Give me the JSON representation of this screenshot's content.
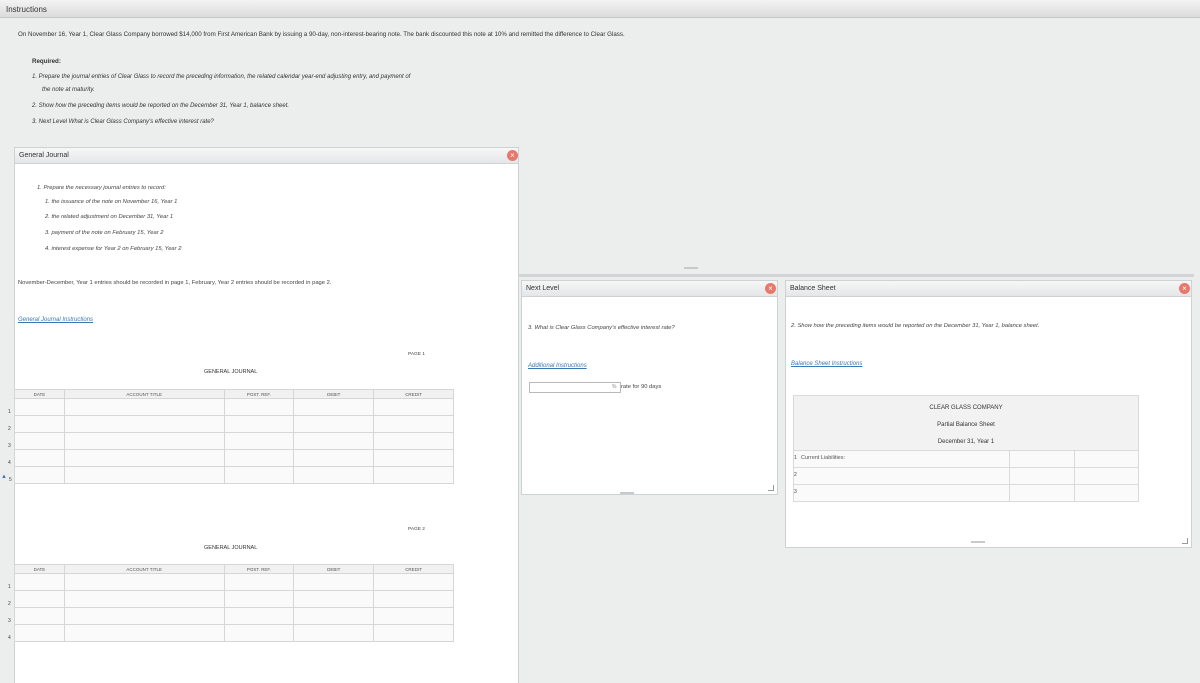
{
  "window": {
    "title": "Instructions"
  },
  "intro": "On November 16, Year 1, Clear Glass Company borrowed $14,000 from First American Bank by issuing a 90-day, non-interest-bearing note. The bank discounted this note at 10% and remitted the difference to Clear Glass.",
  "required": {
    "title": "Required:",
    "items": [
      "1. Prepare the journal entries of Clear Glass to record the preceding information, the related calendar year-end adjusting entry, and payment of",
      "the note at maturity.",
      "2. Show how the preceding items would be reported on the December 31, Year 1, balance sheet.",
      "3. Next Level What is Clear Glass Company's effective interest rate?"
    ]
  },
  "journal_panel": {
    "title": "General Journal",
    "close": "×",
    "prompt": "1. Prepare the necessary journal entries to record:",
    "tasks": [
      "1. the issuance of the note on November 16, Year 1",
      "2. the related adjustment on December 31, Year 1",
      "3. payment of the note on February 15, Year 2",
      "4. interest expense for Year 2 on February 15, Year 2"
    ],
    "note": "November-December, Year 1 entries should be recorded in page 1, February, Year 2 entries should be recorded in page 2.",
    "link": "General Journal Instructions",
    "journal_title": "GENERAL JOURNAL",
    "columns": [
      "DATE",
      "ACCOUNT TITLE",
      "POST. REF.",
      "DEBIT",
      "CREDIT"
    ],
    "page1": {
      "label": "PAGE 1",
      "rows": [
        "1",
        "2",
        "3",
        "4",
        "5"
      ]
    },
    "page2": {
      "label": "PAGE 2",
      "rows": [
        "1",
        "2",
        "3",
        "4"
      ]
    },
    "cursor_marker": "▲"
  },
  "next_level_panel": {
    "title": "Next Level",
    "close": "×",
    "question": "3. What is Clear Glass Company's effective interest rate?",
    "link": "Additional Instructions",
    "input_value": "",
    "unit": "%",
    "suffix": "rate for 90 days"
  },
  "balance_panel": {
    "title": "Balance Sheet",
    "close": "×",
    "question": "2. Show how the preceding items would be reported on the December 31, Year 1, balance sheet.",
    "link": "Balance Sheet Instructions",
    "company": "CLEAR GLASS COMPANY",
    "statement": "Partial Balance Sheet",
    "date": "December 31, Year 1",
    "rows": [
      {
        "num": "1",
        "label": "Current Liabilities:"
      },
      {
        "num": "2",
        "label": ""
      },
      {
        "num": "3",
        "label": ""
      }
    ]
  }
}
